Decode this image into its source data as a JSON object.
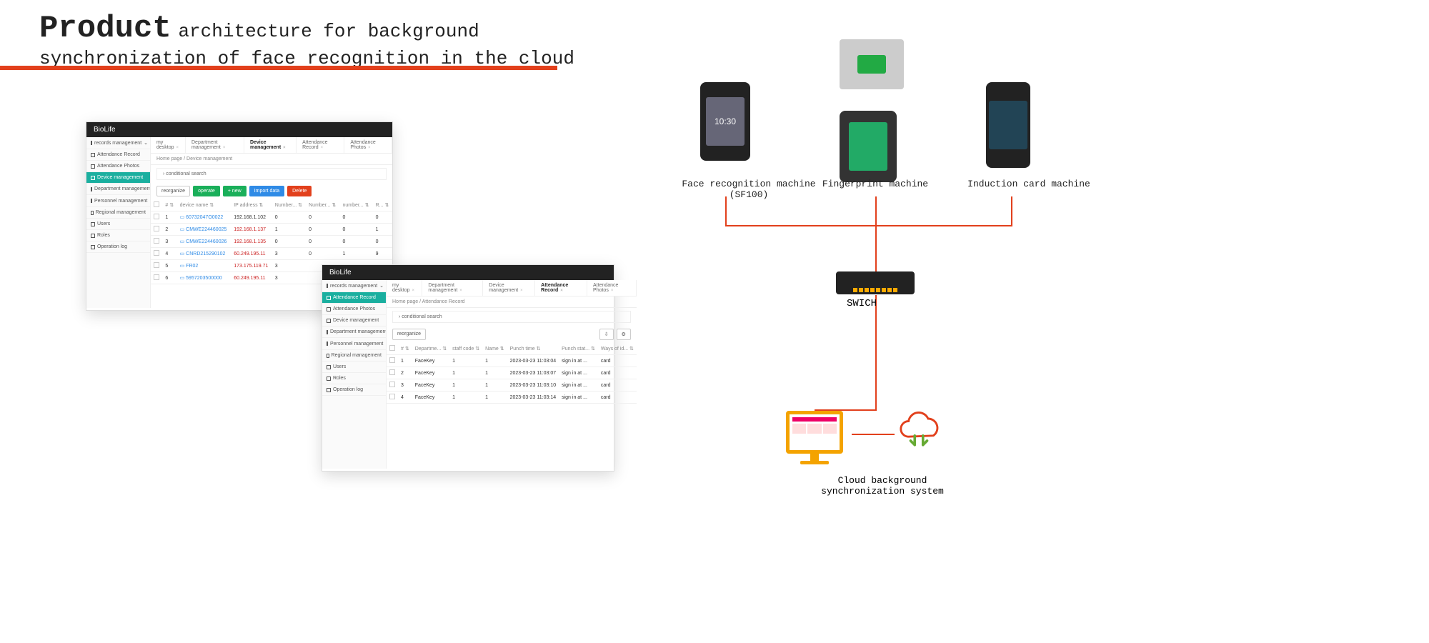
{
  "title": {
    "word_big": "Product",
    "rest_line1": " architecture for background",
    "line2": "synchronization of face recognition in the cloud"
  },
  "app1": {
    "brand": "BioLife",
    "sidebar": [
      {
        "label": "records management",
        "sel": false,
        "expand": true
      },
      {
        "label": "Attendance Record",
        "sel": false
      },
      {
        "label": "Attendance Photos",
        "sel": false
      },
      {
        "label": "Device management",
        "sel": true
      },
      {
        "label": "Department management",
        "sel": false
      },
      {
        "label": "Personnel management",
        "sel": false,
        "expand": true
      },
      {
        "label": "Regional management",
        "sel": false
      },
      {
        "label": "Users",
        "sel": false
      },
      {
        "label": "Roles",
        "sel": false
      },
      {
        "label": "Operation log",
        "sel": false
      }
    ],
    "tabs": [
      {
        "label": "my desktop",
        "active": false
      },
      {
        "label": "Department management",
        "active": false
      },
      {
        "label": "Device management",
        "active": true
      },
      {
        "label": "Attendance Record",
        "active": false
      },
      {
        "label": "Attendance Photos",
        "active": false
      }
    ],
    "breadcrumb": "Home page / Device management",
    "cond_search": "conditional search",
    "toolbar": {
      "reorganize": "reorganize",
      "operate": "operate",
      "new": "+ new",
      "import": "Import data",
      "delete": "Delete"
    },
    "columns": [
      "#",
      "device name",
      "IP address",
      "Number...",
      "Number...",
      "number...",
      "R..."
    ],
    "rows": [
      {
        "n": "1",
        "name": "60732047O0022",
        "ip": "192.168.1.102",
        "c1": "0",
        "c2": "0",
        "c3": "0",
        "c4": "0",
        "ipred": false
      },
      {
        "n": "2",
        "name": "CMWE224460025",
        "ip": "192.168.1.137",
        "c1": "1",
        "c2": "0",
        "c3": "0",
        "c4": "1",
        "ipred": true
      },
      {
        "n": "3",
        "name": "CMWE224460026",
        "ip": "192.168.1.135",
        "c1": "0",
        "c2": "0",
        "c3": "0",
        "c4": "0",
        "ipred": true
      },
      {
        "n": "4",
        "name": "CNRD215290102",
        "ip": "60.249.195.11",
        "c1": "3",
        "c2": "0",
        "c3": "1",
        "c4": "9",
        "ipred": true
      },
      {
        "n": "5",
        "name": "FR02",
        "ip": "173.175.119.71",
        "c1": "3",
        "c2": "",
        "c3": "",
        "c4": "",
        "ipred": true
      },
      {
        "n": "6",
        "name": "5957203500000",
        "ip": "60.249.195.11",
        "c1": "3",
        "c2": "",
        "c3": "",
        "c4": "",
        "ipred": true
      }
    ]
  },
  "app2": {
    "brand": "BioLife",
    "sidebar": [
      {
        "label": "records management",
        "sel": false,
        "expand": true
      },
      {
        "label": "Attendance Record",
        "sel": true
      },
      {
        "label": "Attendance Photos",
        "sel": false
      },
      {
        "label": "Device management",
        "sel": false
      },
      {
        "label": "Department management",
        "sel": false
      },
      {
        "label": "Personnel management",
        "sel": false,
        "expand": true
      },
      {
        "label": "Regional management",
        "sel": false
      },
      {
        "label": "Users",
        "sel": false
      },
      {
        "label": "Roles",
        "sel": false
      },
      {
        "label": "Operation log",
        "sel": false
      }
    ],
    "tabs": [
      {
        "label": "my desktop",
        "active": false
      },
      {
        "label": "Department management",
        "active": false
      },
      {
        "label": "Device management",
        "active": false
      },
      {
        "label": "Attendance Record",
        "active": true
      },
      {
        "label": "Attendance Photos",
        "active": false
      }
    ],
    "breadcrumb": "Home page / Attendance Record",
    "cond_search": "conditional search",
    "toolbar": {
      "reorganize": "reorganize"
    },
    "columns": [
      "#",
      "Departme...",
      "staff code",
      "Name",
      "Punch time",
      "Punch stat...",
      "Ways of id..."
    ],
    "rows": [
      {
        "n": "1",
        "dep": "FaceKey",
        "code": "1",
        "name": "1",
        "time": "2023-03-23 11:03:04",
        "stat": "sign in at ...",
        "way": "card"
      },
      {
        "n": "2",
        "dep": "FaceKey",
        "code": "1",
        "name": "1",
        "time": "2023-03-23 11:03:07",
        "stat": "sign in at ...",
        "way": "card"
      },
      {
        "n": "3",
        "dep": "FaceKey",
        "code": "1",
        "name": "1",
        "time": "2023-03-23 11:03:10",
        "stat": "sign in at ...",
        "way": "card"
      },
      {
        "n": "4",
        "dep": "FaceKey",
        "code": "1",
        "name": "1",
        "time": "2023-03-23 11:03:14",
        "stat": "sign in at ...",
        "way": "card"
      }
    ]
  },
  "diagram": {
    "face_time": "10:30",
    "face_label": "Face recognition machine\n(SF100)",
    "fp_label": "Fingerprint machine",
    "card_label": "Induction card machine",
    "switch_label": "SWICH",
    "cloud_label": "Cloud background\nsynchronization system"
  }
}
